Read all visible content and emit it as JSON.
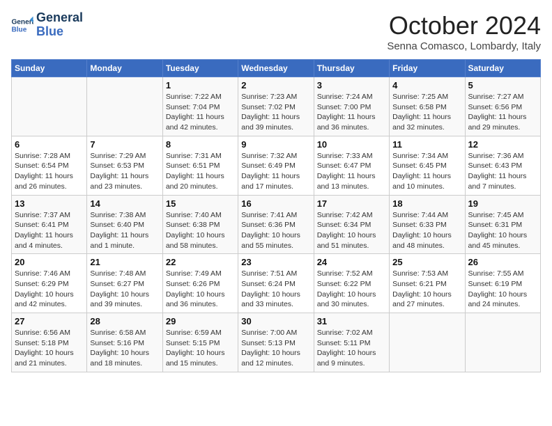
{
  "header": {
    "logo_line1": "General",
    "logo_line2": "Blue",
    "month_title": "October 2024",
    "location": "Senna Comasco, Lombardy, Italy"
  },
  "weekdays": [
    "Sunday",
    "Monday",
    "Tuesday",
    "Wednesday",
    "Thursday",
    "Friday",
    "Saturday"
  ],
  "weeks": [
    [
      {
        "day": "",
        "empty": true
      },
      {
        "day": "",
        "empty": true
      },
      {
        "day": "1",
        "sunrise": "Sunrise: 7:22 AM",
        "sunset": "Sunset: 7:04 PM",
        "daylight": "Daylight: 11 hours and 42 minutes."
      },
      {
        "day": "2",
        "sunrise": "Sunrise: 7:23 AM",
        "sunset": "Sunset: 7:02 PM",
        "daylight": "Daylight: 11 hours and 39 minutes."
      },
      {
        "day": "3",
        "sunrise": "Sunrise: 7:24 AM",
        "sunset": "Sunset: 7:00 PM",
        "daylight": "Daylight: 11 hours and 36 minutes."
      },
      {
        "day": "4",
        "sunrise": "Sunrise: 7:25 AM",
        "sunset": "Sunset: 6:58 PM",
        "daylight": "Daylight: 11 hours and 32 minutes."
      },
      {
        "day": "5",
        "sunrise": "Sunrise: 7:27 AM",
        "sunset": "Sunset: 6:56 PM",
        "daylight": "Daylight: 11 hours and 29 minutes."
      }
    ],
    [
      {
        "day": "6",
        "sunrise": "Sunrise: 7:28 AM",
        "sunset": "Sunset: 6:54 PM",
        "daylight": "Daylight: 11 hours and 26 minutes."
      },
      {
        "day": "7",
        "sunrise": "Sunrise: 7:29 AM",
        "sunset": "Sunset: 6:53 PM",
        "daylight": "Daylight: 11 hours and 23 minutes."
      },
      {
        "day": "8",
        "sunrise": "Sunrise: 7:31 AM",
        "sunset": "Sunset: 6:51 PM",
        "daylight": "Daylight: 11 hours and 20 minutes."
      },
      {
        "day": "9",
        "sunrise": "Sunrise: 7:32 AM",
        "sunset": "Sunset: 6:49 PM",
        "daylight": "Daylight: 11 hours and 17 minutes."
      },
      {
        "day": "10",
        "sunrise": "Sunrise: 7:33 AM",
        "sunset": "Sunset: 6:47 PM",
        "daylight": "Daylight: 11 hours and 13 minutes."
      },
      {
        "day": "11",
        "sunrise": "Sunrise: 7:34 AM",
        "sunset": "Sunset: 6:45 PM",
        "daylight": "Daylight: 11 hours and 10 minutes."
      },
      {
        "day": "12",
        "sunrise": "Sunrise: 7:36 AM",
        "sunset": "Sunset: 6:43 PM",
        "daylight": "Daylight: 11 hours and 7 minutes."
      }
    ],
    [
      {
        "day": "13",
        "sunrise": "Sunrise: 7:37 AM",
        "sunset": "Sunset: 6:41 PM",
        "daylight": "Daylight: 11 hours and 4 minutes."
      },
      {
        "day": "14",
        "sunrise": "Sunrise: 7:38 AM",
        "sunset": "Sunset: 6:40 PM",
        "daylight": "Daylight: 11 hours and 1 minute."
      },
      {
        "day": "15",
        "sunrise": "Sunrise: 7:40 AM",
        "sunset": "Sunset: 6:38 PM",
        "daylight": "Daylight: 10 hours and 58 minutes."
      },
      {
        "day": "16",
        "sunrise": "Sunrise: 7:41 AM",
        "sunset": "Sunset: 6:36 PM",
        "daylight": "Daylight: 10 hours and 55 minutes."
      },
      {
        "day": "17",
        "sunrise": "Sunrise: 7:42 AM",
        "sunset": "Sunset: 6:34 PM",
        "daylight": "Daylight: 10 hours and 51 minutes."
      },
      {
        "day": "18",
        "sunrise": "Sunrise: 7:44 AM",
        "sunset": "Sunset: 6:33 PM",
        "daylight": "Daylight: 10 hours and 48 minutes."
      },
      {
        "day": "19",
        "sunrise": "Sunrise: 7:45 AM",
        "sunset": "Sunset: 6:31 PM",
        "daylight": "Daylight: 10 hours and 45 minutes."
      }
    ],
    [
      {
        "day": "20",
        "sunrise": "Sunrise: 7:46 AM",
        "sunset": "Sunset: 6:29 PM",
        "daylight": "Daylight: 10 hours and 42 minutes."
      },
      {
        "day": "21",
        "sunrise": "Sunrise: 7:48 AM",
        "sunset": "Sunset: 6:27 PM",
        "daylight": "Daylight: 10 hours and 39 minutes."
      },
      {
        "day": "22",
        "sunrise": "Sunrise: 7:49 AM",
        "sunset": "Sunset: 6:26 PM",
        "daylight": "Daylight: 10 hours and 36 minutes."
      },
      {
        "day": "23",
        "sunrise": "Sunrise: 7:51 AM",
        "sunset": "Sunset: 6:24 PM",
        "daylight": "Daylight: 10 hours and 33 minutes."
      },
      {
        "day": "24",
        "sunrise": "Sunrise: 7:52 AM",
        "sunset": "Sunset: 6:22 PM",
        "daylight": "Daylight: 10 hours and 30 minutes."
      },
      {
        "day": "25",
        "sunrise": "Sunrise: 7:53 AM",
        "sunset": "Sunset: 6:21 PM",
        "daylight": "Daylight: 10 hours and 27 minutes."
      },
      {
        "day": "26",
        "sunrise": "Sunrise: 7:55 AM",
        "sunset": "Sunset: 6:19 PM",
        "daylight": "Daylight: 10 hours and 24 minutes."
      }
    ],
    [
      {
        "day": "27",
        "sunrise": "Sunrise: 6:56 AM",
        "sunset": "Sunset: 5:18 PM",
        "daylight": "Daylight: 10 hours and 21 minutes."
      },
      {
        "day": "28",
        "sunrise": "Sunrise: 6:58 AM",
        "sunset": "Sunset: 5:16 PM",
        "daylight": "Daylight: 10 hours and 18 minutes."
      },
      {
        "day": "29",
        "sunrise": "Sunrise: 6:59 AM",
        "sunset": "Sunset: 5:15 PM",
        "daylight": "Daylight: 10 hours and 15 minutes."
      },
      {
        "day": "30",
        "sunrise": "Sunrise: 7:00 AM",
        "sunset": "Sunset: 5:13 PM",
        "daylight": "Daylight: 10 hours and 12 minutes."
      },
      {
        "day": "31",
        "sunrise": "Sunrise: 7:02 AM",
        "sunset": "Sunset: 5:11 PM",
        "daylight": "Daylight: 10 hours and 9 minutes."
      },
      {
        "day": "",
        "empty": true
      },
      {
        "day": "",
        "empty": true
      }
    ]
  ]
}
